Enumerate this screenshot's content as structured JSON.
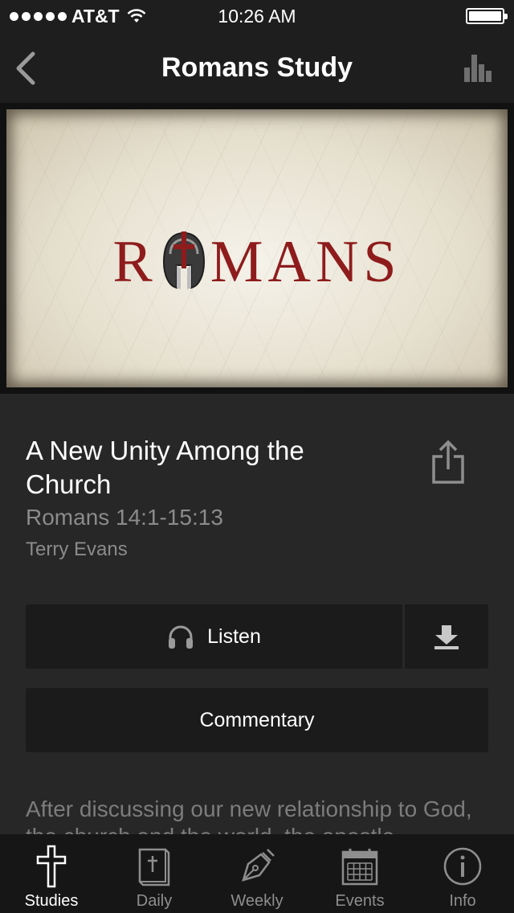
{
  "status_bar": {
    "carrier": "AT&T",
    "time": "10:26 AM"
  },
  "nav": {
    "title": "Romans Study"
  },
  "banner": {
    "word_left": "R",
    "word_right": "MANS"
  },
  "study": {
    "title": "A New Unity Among the Church",
    "reference": "Romans 14:1-15:13",
    "author": "Terry Evans"
  },
  "actions": {
    "listen_label": "Listen",
    "commentary_label": "Commentary"
  },
  "description": "After discussing our new relationship to God, the church and the world, the apostle",
  "tabs": [
    {
      "label": "Studies",
      "icon": "cross-icon",
      "active": true
    },
    {
      "label": "Daily",
      "icon": "bible-icon",
      "active": false
    },
    {
      "label": "Weekly",
      "icon": "pen-nib-icon",
      "active": false
    },
    {
      "label": "Events",
      "icon": "calendar-icon",
      "active": false
    },
    {
      "label": "Info",
      "icon": "info-icon",
      "active": false
    }
  ],
  "colors": {
    "background": "#272727",
    "bars": "#1e1e1e",
    "button": "#1b1b1b",
    "banner_text": "#8e1c1c",
    "secondary_text": "#8b8b8b"
  }
}
